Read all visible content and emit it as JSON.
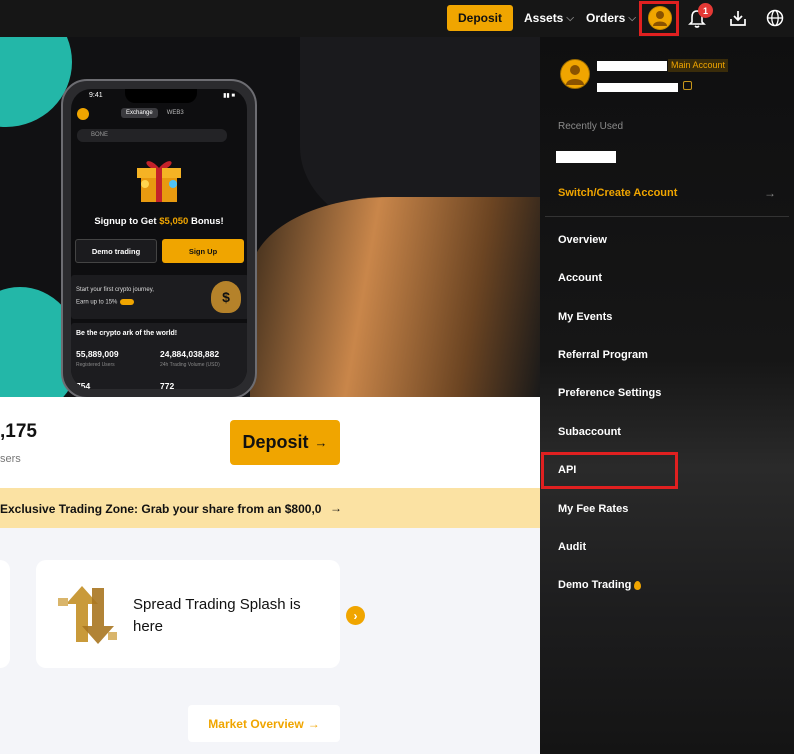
{
  "nav": {
    "deposit_label": "Deposit",
    "assets_label": "Assets",
    "orders_label": "Orders",
    "notification_count": "1"
  },
  "hero": {
    "phone": {
      "time": "9:41",
      "tab_exchange": "Exchange",
      "tab_web3": "WEB3",
      "search_placeholder": "BONE",
      "headline_prefix": "Signup to Get ",
      "headline_amount": "$5,050",
      "headline_suffix": " Bonus!",
      "demo_btn": "Demo trading",
      "signup_btn": "Sign Up",
      "card1_line1": "Start your first crypto journey,",
      "card1_line2": "Earn up to 15%",
      "card2_title": "Be the crypto ark of the world!",
      "stat1_value": "55,889,009",
      "stat1_label": "Registered Users",
      "stat2_value": "24,884,038,882",
      "stat2_label": "24h Trading Volume (USD)",
      "stat3_value": "754",
      "stat4_value": "772"
    }
  },
  "main": {
    "stat_value": ",175",
    "stat_label": "sers",
    "deposit_label": "Deposit",
    "banner_text": "Exclusive Trading Zone: Grab your share from an $800,0",
    "promo_text": "Spread Trading Splash is here",
    "market_overview_label": "Market Overview"
  },
  "panel": {
    "main_account_tag": "Main Account",
    "recently_used_label": "Recently Used",
    "switch_label": "Switch/Create Account",
    "menu": [
      "Overview",
      "Account",
      "My Events",
      "Referral Program",
      "Preference Settings",
      "Subaccount",
      "API",
      "My Fee Rates",
      "Audit",
      "Demo Trading"
    ]
  },
  "colors": {
    "accent": "#f0a500",
    "highlight": "#e02020",
    "teal": "#23b7a8"
  }
}
